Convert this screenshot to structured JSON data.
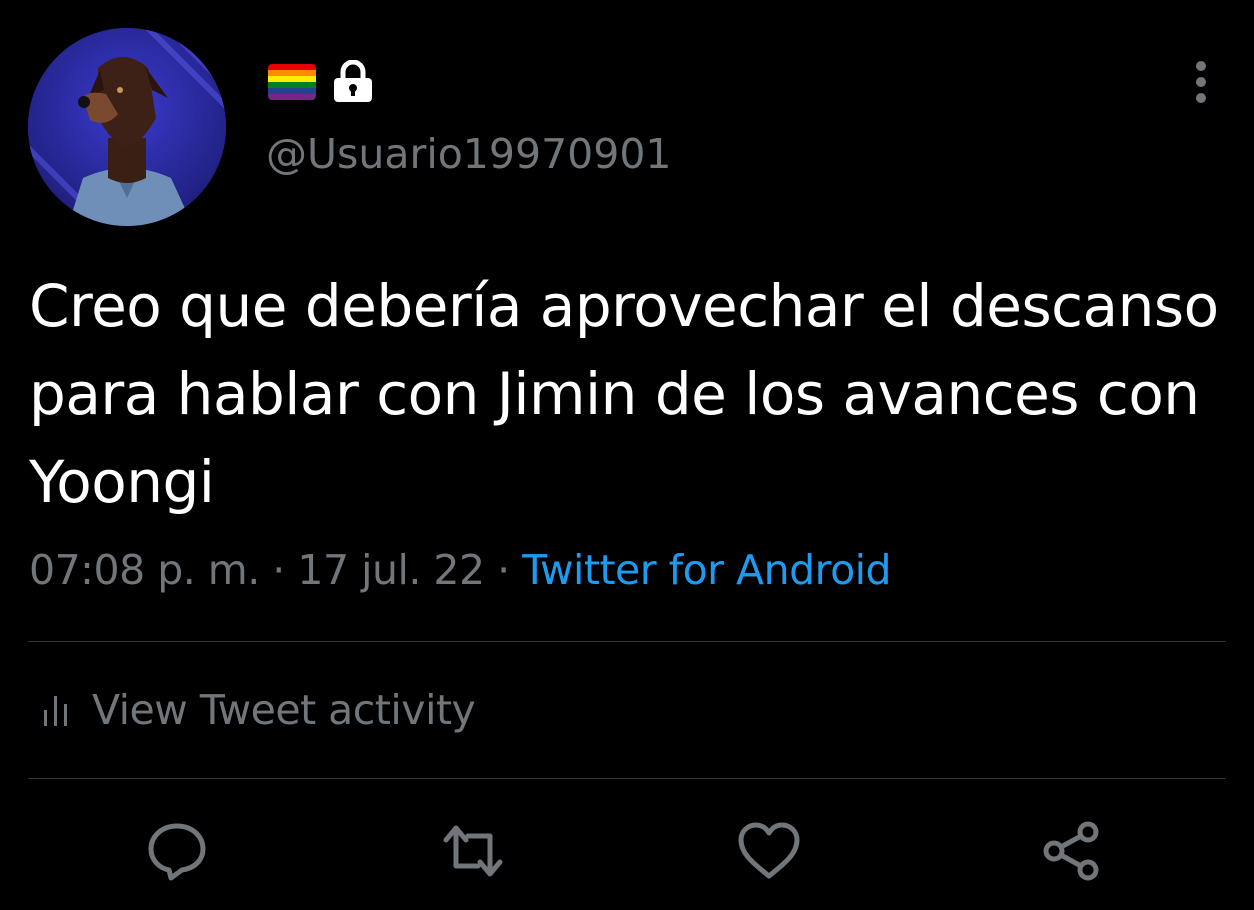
{
  "user": {
    "handle": "@Usuario19970901",
    "avatar_icon": "doberman-dog-avatar",
    "flag_icon": "rainbow-flag-icon",
    "lock_icon": "lock-icon"
  },
  "tweet": {
    "text": "Creo que debería aprovechar el descanso para hablar con Jimin de los avances con Yoongi",
    "time": "07:08 p. m.",
    "separator": " · ",
    "date": "17 jul. 22",
    "source": "Twitter for Android"
  },
  "activity": {
    "label": "View Tweet activity",
    "icon": "bar-chart-icon"
  },
  "actions": {
    "reply_icon": "reply-icon",
    "retweet_icon": "retweet-icon",
    "like_icon": "heart-icon",
    "share_icon": "share-icon"
  },
  "colors": {
    "background": "#000000",
    "text": "#ffffff",
    "muted": "#71767b",
    "link": "#1d9bf0",
    "divider": "#2f3336",
    "flag": [
      "#e40303",
      "#ff8c00",
      "#ffed00",
      "#008026",
      "#24408e",
      "#732982"
    ]
  }
}
